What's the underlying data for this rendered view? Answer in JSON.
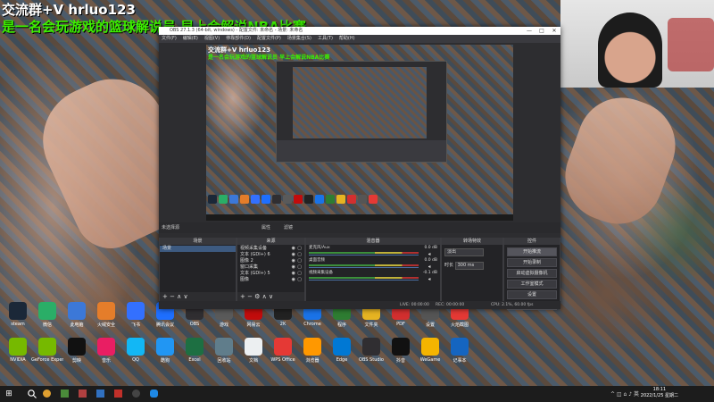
{
  "overlay": {
    "line1": "交流群+V hrluo123",
    "line2": "是一名会玩游戏的篮球解说员 早上会解说NBA比赛"
  },
  "desktop_icons": [
    {
      "label": "steam",
      "icon": "steam-icon",
      "color": "#1b2838"
    },
    {
      "label": "微信",
      "icon": "wechat-icon",
      "color": "#2aae67"
    },
    {
      "label": "此电脑",
      "icon": "computer-icon",
      "color": "#3c78d8"
    },
    {
      "label": "火绒安全",
      "icon": "security-icon",
      "color": "#e57d2a"
    },
    {
      "label": "飞书",
      "icon": "feishu-icon",
      "color": "#3370ff"
    },
    {
      "label": "腾讯会议",
      "icon": "meeting-icon",
      "color": "#1e6fff"
    },
    {
      "label": "OBS",
      "icon": "obs-icon",
      "color": "#302e31"
    },
    {
      "label": "游戏",
      "icon": "game-icon",
      "color": "#5a5a5a"
    },
    {
      "label": "网易云",
      "icon": "music-icon",
      "color": "#c20c0c"
    },
    {
      "label": "2K",
      "icon": "2k-icon",
      "color": "#222"
    },
    {
      "label": "Chrome",
      "icon": "chrome-icon",
      "color": "#1a73e8"
    },
    {
      "label": "程序",
      "icon": "app-icon",
      "color": "#2e7d32"
    },
    {
      "label": "文件夹",
      "icon": "folder-icon",
      "color": "#e6b422"
    },
    {
      "label": "PDF",
      "icon": "pdf-icon",
      "color": "#d32f2f"
    },
    {
      "label": "设置",
      "icon": "settings-icon",
      "color": "#555"
    },
    {
      "label": "火焰截图",
      "icon": "fire-icon",
      "color": "#e53935"
    },
    {
      "label": "NVIDIA",
      "icon": "nvidia-icon",
      "color": "#76b900"
    },
    {
      "label": "GeForce Experience",
      "icon": "geforce-icon",
      "color": "#76b900"
    },
    {
      "label": "剪映",
      "icon": "capcut-icon",
      "color": "#111"
    },
    {
      "label": "音乐",
      "icon": "music-note-icon",
      "color": "#e91e63"
    },
    {
      "label": "QQ",
      "icon": "qq-icon",
      "color": "#12b7f5"
    },
    {
      "label": "酷狗",
      "icon": "kugou-icon",
      "color": "#2196f3"
    },
    {
      "label": "Excel",
      "icon": "excel-icon",
      "color": "#1d6f42"
    },
    {
      "label": "回收站",
      "icon": "recycle-icon",
      "color": "#607d8b"
    },
    {
      "label": "文档",
      "icon": "document-icon",
      "color": "#eceff1"
    },
    {
      "label": "WPS Office",
      "icon": "wps-icon",
      "color": "#e53935"
    },
    {
      "label": "浏览器",
      "icon": "browser-icon",
      "color": "#ff9800"
    },
    {
      "label": "Edge",
      "icon": "edge-icon",
      "color": "#0078d4"
    },
    {
      "label": "OBS Studio",
      "icon": "obs-studio-icon",
      "color": "#302e31"
    },
    {
      "label": "抖音",
      "icon": "douyin-icon",
      "color": "#111"
    },
    {
      "label": "WeGame",
      "icon": "wegame-icon",
      "color": "#f4b400"
    },
    {
      "label": "记事本",
      "icon": "notepad-icon",
      "color": "#1565c0"
    }
  ],
  "obs": {
    "title": "OBS 27.1.3 (64-bit, windows) - 配置文件: 未命名 - 场景: 未命名",
    "menu": [
      "文件(F)",
      "编辑(E)",
      "视图(V)",
      "停靠部件(D)",
      "配置文件(P)",
      "场景集合(S)",
      "工具(T)",
      "帮助(H)"
    ],
    "window_controls": {
      "minimize": "—",
      "maximize": "□",
      "close": "✕"
    },
    "scene_bar": {
      "label": "未选择源",
      "props": "属性",
      "filters": "滤镜"
    },
    "scenes": {
      "title": "场景",
      "items": [
        "场景"
      ],
      "footer": "+ − ∧ ∨"
    },
    "sources": {
      "title": "来源",
      "items": [
        "视频采集设备",
        "文本 (GDI+) 6",
        "图像 2",
        "窗口采集",
        "文本 (GDI+) 5",
        "图像"
      ],
      "footer": "+ − ⚙ ∧ ∨"
    },
    "mixer": {
      "title": "混音器",
      "channels": [
        {
          "name": "麦克风/Aux",
          "db": "0.0 dB"
        },
        {
          "name": "桌面音频",
          "db": "0.0 dB"
        },
        {
          "name": "视频采集设备",
          "db": "-0.1 dB"
        }
      ]
    },
    "transitions": {
      "title": "转场特效",
      "type": "淡出",
      "duration_label": "时长",
      "duration": "300 ms"
    },
    "controls": {
      "title": "控件",
      "buttons": [
        "开始推流",
        "开始录制",
        "启动虚拟摄像机",
        "工作室模式",
        "设置",
        "退出"
      ],
      "active": "开始推流"
    },
    "status": {
      "live": "LIVE: 00:00:00",
      "rec": "REC: 00:00:00",
      "cpu": "CPU: 2.1%, 60.00 fps"
    }
  },
  "taskbar": {
    "start": "⊞",
    "clock_time": "18:11",
    "clock_date": "2022/1/25 星期二",
    "tray": "^ ◫ ⌂ ♪ 英"
  }
}
